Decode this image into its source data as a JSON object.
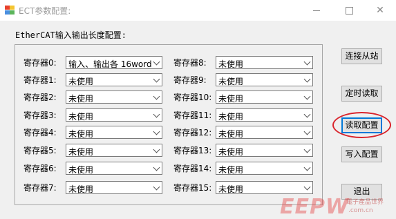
{
  "window": {
    "title": "ECT参数配置:"
  },
  "section_label": "EtherCAT输入输出长度配置:",
  "registers_left": [
    {
      "label": "寄存器0:",
      "value": "输入、输出各 16word"
    },
    {
      "label": "寄存器1:",
      "value": "未使用"
    },
    {
      "label": "寄存器2:",
      "value": "未使用"
    },
    {
      "label": "寄存器3:",
      "value": "未使用"
    },
    {
      "label": "寄存器4:",
      "value": "未使用"
    },
    {
      "label": "寄存器5:",
      "value": "未使用"
    },
    {
      "label": "寄存器6:",
      "value": "未使用"
    },
    {
      "label": "寄存器7:",
      "value": "未使用"
    }
  ],
  "registers_right": [
    {
      "label": "寄存器8:",
      "value": "未使用"
    },
    {
      "label": "寄存器9:",
      "value": "未使用"
    },
    {
      "label": "寄存器10:",
      "value": "未使用"
    },
    {
      "label": "寄存器11:",
      "value": "未使用"
    },
    {
      "label": "寄存器12:",
      "value": "未使用"
    },
    {
      "label": "寄存器13:",
      "value": "未使用"
    },
    {
      "label": "寄存器14:",
      "value": "未使用"
    },
    {
      "label": "寄存器15:",
      "value": "未使用"
    }
  ],
  "buttons": {
    "connect": "连接从站",
    "timed_read": "定时读取",
    "read_config": "读取配置",
    "write_config": "写入配置",
    "exit": "退出"
  },
  "watermark": {
    "logo": "EEPW",
    "cn": "電子產品世界",
    "url": ".com.cn"
  },
  "colors": {
    "highlight": "#d9232b",
    "focus": "#0078d7"
  }
}
